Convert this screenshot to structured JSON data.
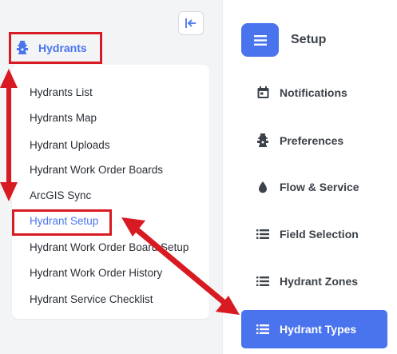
{
  "sidebar": {
    "section": {
      "label": "Hydrants",
      "icon": "fire-hydrant-icon"
    },
    "collapse_icon": "collapse-left-icon",
    "items": [
      {
        "label": "Hydrants List"
      },
      {
        "label": "Hydrants Map"
      },
      {
        "label": "Hydrant Uploads"
      },
      {
        "label": "Hydrant Work Order Boards"
      },
      {
        "label": "ArcGIS Sync"
      },
      {
        "label": "Hydrant Setup",
        "active": true
      },
      {
        "label": "Hydrant Work Order Board Setup"
      },
      {
        "label": "Hydrant Work Order History"
      },
      {
        "label": "Hydrant Service Checklist"
      }
    ]
  },
  "setup": {
    "title": "Setup",
    "menu_icon": "hamburger-icon",
    "items": [
      {
        "label": "Notifications",
        "icon": "calendar-icon"
      },
      {
        "label": "Preferences",
        "icon": "fire-hydrant-icon"
      },
      {
        "label": "Flow & Service",
        "icon": "water-drop-icon"
      },
      {
        "label": "Field Selection",
        "icon": "list-icon"
      },
      {
        "label": "Hydrant Zones",
        "icon": "list-icon"
      }
    ],
    "active_item": {
      "label": "Hydrant Types",
      "icon": "list-icon"
    }
  },
  "colors": {
    "accent": "#4a74ee",
    "annotation_red": "#d81b22",
    "sidebar_bg": "#f3f4f6",
    "text": "#3c4249"
  }
}
